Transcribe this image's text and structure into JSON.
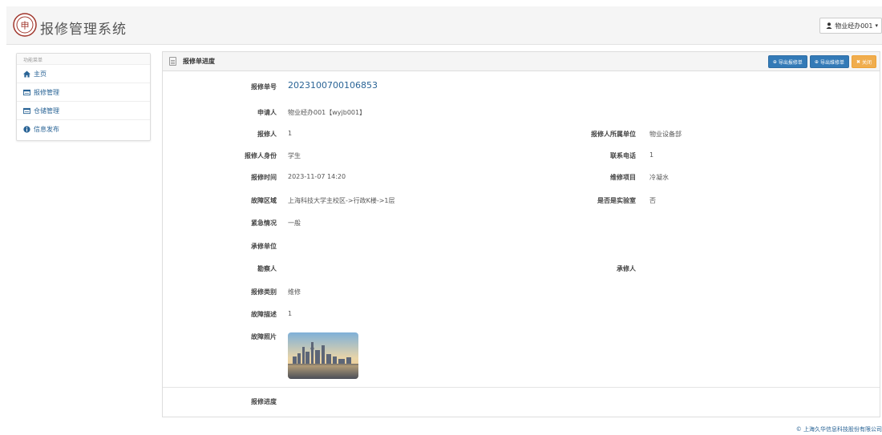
{
  "app": {
    "title": "报修管理系统",
    "user_label": "物业经办001"
  },
  "sidebar": {
    "heading": "功能菜单",
    "items": [
      {
        "label": "主页",
        "icon": "home-icon"
      },
      {
        "label": "报修管理",
        "icon": "list-icon"
      },
      {
        "label": "仓储管理",
        "icon": "list-icon"
      },
      {
        "label": "信息发布",
        "icon": "info-icon"
      }
    ]
  },
  "panel": {
    "title": "报修单进度",
    "buttons": {
      "export_report": "导出报修单",
      "export_repair": "导出维修单",
      "close": "关闭"
    }
  },
  "form": {
    "order_no_label": "报修单号",
    "order_no": "2023100700106853",
    "applicant_label": "申请人",
    "applicant": "物业经办001【wyjb001】",
    "reporter_label": "报修人",
    "reporter": "1",
    "reporter_unit_label": "报修人所属单位",
    "reporter_unit": "物业设备部",
    "identity_label": "报修人身份",
    "identity": "学生",
    "phone_label": "联系电话",
    "phone": "1",
    "time_label": "报修时间",
    "time": "2023-11-07 14:20",
    "item_label": "维修项目",
    "item": "冷凝水",
    "area_label": "故障区域",
    "area": "上海科技大学主校区->行政K楼->1层",
    "lab_label": "是否是实验室",
    "lab": "否",
    "urgency_label": "紧急情况",
    "urgency": "一般",
    "contractor_label": "承修单位",
    "surveyor_label": "勘察人",
    "repairer_label": "承修人",
    "type_label": "报修类别",
    "type": "维修",
    "desc_label": "故障描述",
    "desc": "1",
    "photo_label": "故障照片",
    "progress_label": "报修进度"
  },
  "footer": {
    "copyright": "© 上海久华信息科技股份有限公司"
  },
  "colors": {
    "primary": "#337ab7",
    "warning": "#f0ad4e",
    "link": "#2a6496"
  }
}
